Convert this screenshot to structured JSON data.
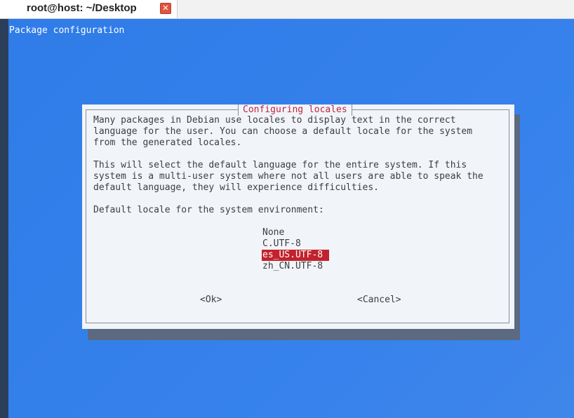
{
  "window": {
    "tab_title": "root@host: ~/Desktop",
    "close_glyph": "✕"
  },
  "terminal": {
    "header": "Package configuration"
  },
  "dialog": {
    "title": "Configuring locales",
    "paragraph1": [
      "Many packages in Debian use locales to display text in the correct",
      "language for the user. You can choose a default locale for the system",
      "from the generated locales."
    ],
    "paragraph2": [
      "This will select the default language for the entire system. If this",
      "system is a multi-user system where not all users are able to speak the",
      "default language, they will experience difficulties."
    ],
    "prompt": "Default locale for the system environment:",
    "options": [
      "None",
      "C.UTF-8",
      "es_US.UTF-8",
      "zh_CN.UTF-8"
    ],
    "selected_option": "es_US.UTF-8",
    "ok_label": "<Ok>",
    "cancel_label": "<Cancel>"
  },
  "colors": {
    "terminal_bg": "#2f7ce8",
    "dialog_bg": "#f1f4f9",
    "accent_red": "#c2222d",
    "title_red": "#c4233a"
  }
}
